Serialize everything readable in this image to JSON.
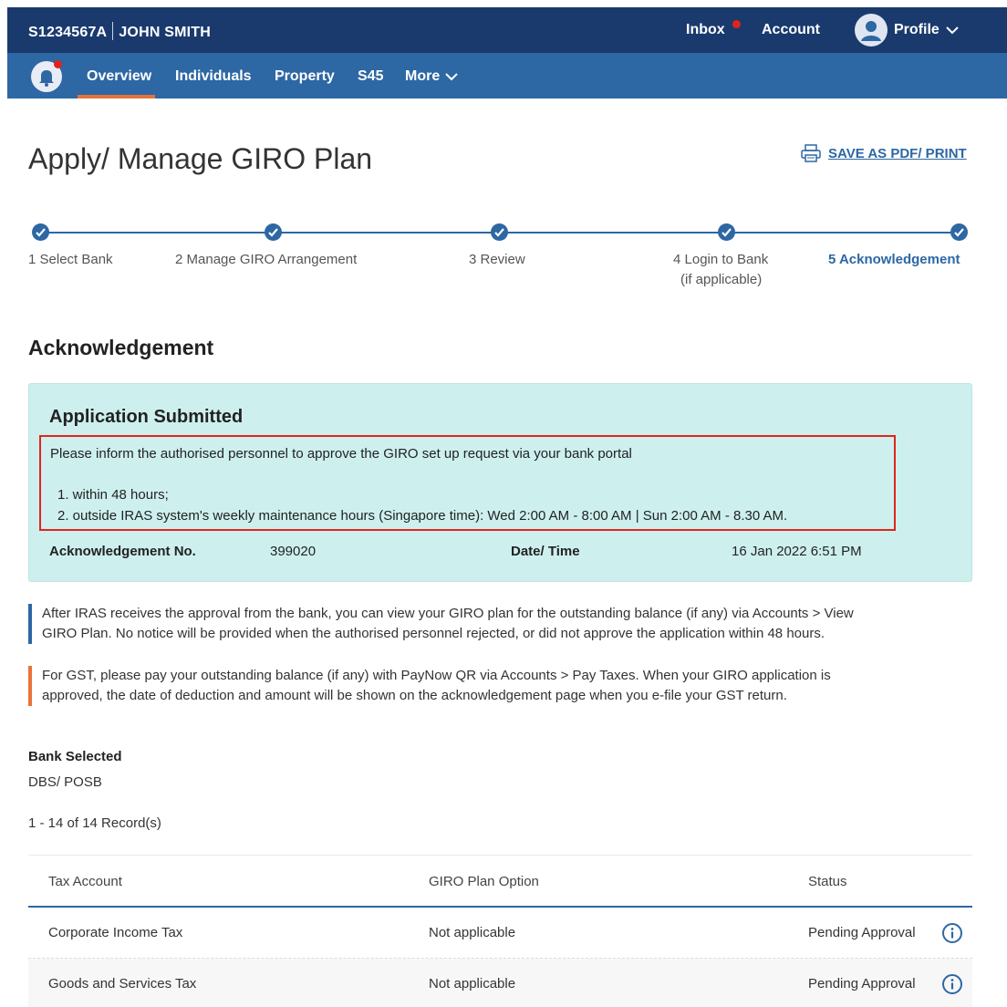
{
  "header": {
    "user_id": "S1234567A",
    "user_name": "JOHN SMITH",
    "inbox": "Inbox",
    "account": "Account",
    "profile": "Profile"
  },
  "nav": {
    "items": [
      "Overview",
      "Individuals",
      "Property",
      "S45",
      "More"
    ]
  },
  "page": {
    "title": "Apply/ Manage GIRO Plan",
    "print_link": "SAVE AS PDF/ PRINT"
  },
  "steps": [
    {
      "label": "1 Select Bank"
    },
    {
      "label": "2 Manage GIRO Arrangement"
    },
    {
      "label": "3 Review"
    },
    {
      "label": "4 Login to Bank",
      "sub": "(if applicable)"
    },
    {
      "label": "5 Acknowledgement"
    }
  ],
  "acknowledgement": {
    "heading": "Acknowledgement",
    "box_title": "Application Submitted",
    "notice_text": "Please inform the authorised personnel to approve the GIRO set up request via your bank portal",
    "notice_items": [
      "1. within 48 hours;",
      "2. outside IRAS system's weekly maintenance hours (Singapore time): Wed 2:00 AM - 8:00 AM | Sun 2:00 AM - 8.30 AM."
    ],
    "ack_no_label": "Acknowledgement No.",
    "ack_no_value": "399020",
    "datetime_label": "Date/ Time",
    "datetime_value": "16 Jan 2022 6:51 PM"
  },
  "info": {
    "blue_line1": "After IRAS receives the approval from the bank, you can view your GIRO plan for the outstanding balance (if any) via Accounts > View",
    "blue_line2": "GIRO Plan. No notice will be provided when the authorised personnel rejected, or did not approve the application within 48 hours.",
    "orange_line1": "For GST, please pay your outstanding balance (if any) with PayNow QR via Accounts > Pay Taxes. When your GIRO application is",
    "orange_line2": "approved, the date of deduction and amount will be shown on the acknowledgement page when you e-file your GST return."
  },
  "bank": {
    "label": "Bank Selected",
    "value": "DBS/ POSB"
  },
  "records_text": "1 - 14 of 14 Record(s)",
  "table": {
    "headers": [
      "Tax Account",
      "GIRO Plan Option",
      "Status"
    ],
    "rows": [
      [
        "Corporate Income Tax",
        "Not applicable",
        "Pending Approval"
      ],
      [
        "Goods and Services Tax",
        "Not applicable",
        "Pending Approval"
      ]
    ]
  },
  "colors": {
    "header_bg": "#1a3a6e",
    "nav_bg": "#2d67a4",
    "active_tab": "#e8733a",
    "ack_box_bg": "#cdf0ef",
    "notice_border": "#e0241b",
    "info_blue_bar": "#2d67a4",
    "info_orange_bar": "#e8733a"
  }
}
